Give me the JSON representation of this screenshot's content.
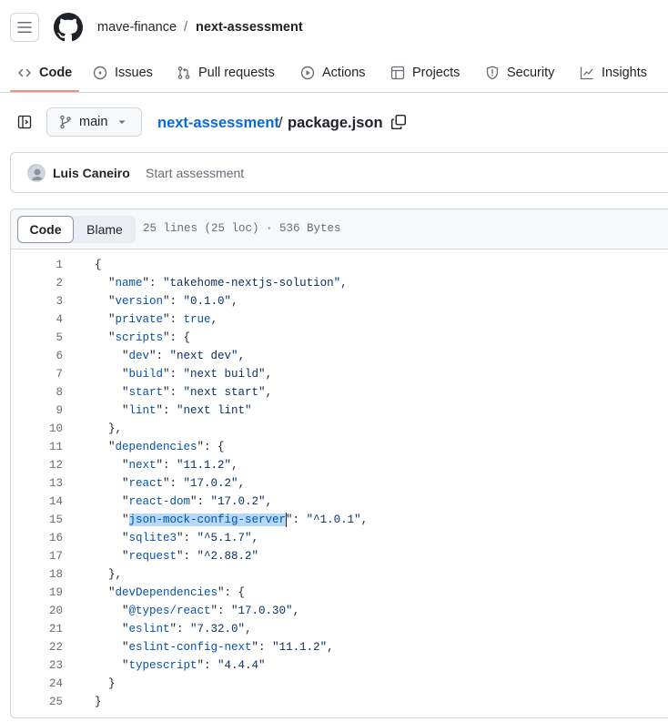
{
  "header": {
    "owner": "mave-finance",
    "separator": "/",
    "repo": "next-assessment"
  },
  "nav": {
    "items": [
      {
        "label": "Code",
        "icon": "code-icon"
      },
      {
        "label": "Issues",
        "icon": "issue-icon"
      },
      {
        "label": "Pull requests",
        "icon": "pull-request-icon"
      },
      {
        "label": "Actions",
        "icon": "play-icon"
      },
      {
        "label": "Projects",
        "icon": "table-icon"
      },
      {
        "label": "Security",
        "icon": "shield-icon"
      },
      {
        "label": "Insights",
        "icon": "graph-icon"
      }
    ],
    "selected": "Code"
  },
  "file": {
    "branch": "main",
    "repo_link": "next-assessment",
    "path_separator": "/",
    "filename": "package.json"
  },
  "commit": {
    "author": "Luis Caneiro",
    "message": "Start assessment"
  },
  "viewer": {
    "tab_code": "Code",
    "tab_blame": "Blame",
    "info": "25 lines (25 loc) · 536 Bytes"
  },
  "code": {
    "line_numbers": [
      "1",
      "2",
      "3",
      "4",
      "5",
      "6",
      "7",
      "8",
      "9",
      "10",
      "11",
      "12",
      "13",
      "14",
      "15",
      "16",
      "17",
      "18",
      "19",
      "20",
      "21",
      "22",
      "23",
      "24",
      "25"
    ],
    "lines": [
      "{",
      "  \"name\": \"takehome-nextjs-solution\",",
      "  \"version\": \"0.1.0\",",
      "  \"private\": true,",
      "  \"scripts\": {",
      "    \"dev\": \"next dev\",",
      "    \"build\": \"next build\",",
      "    \"start\": \"next start\",",
      "    \"lint\": \"next lint\"",
      "  },",
      "  \"dependencies\": {",
      "    \"next\": \"11.1.2\",",
      "    \"react\": \"17.0.2\",",
      "    \"react-dom\": \"17.0.2\",",
      "    \"json-mock-config-server\": \"^1.0.1\",",
      "    \"sqlite3\": \"^5.1.7\",",
      "    \"request\": \"^2.88.2\"",
      "  },",
      "  \"devDependencies\": {",
      "    \"@types/react\": \"17.0.30\",",
      "    \"eslint\": \"7.32.0\",",
      "    \"eslint-config-next\": \"11.1.2\",",
      "    \"typescript\": \"4.4.4\"",
      "  }",
      "}"
    ],
    "selected_text": "json-mock-config-server",
    "selected_line": 15
  },
  "colors": {
    "accent_link": "#0969da",
    "nav_underline": "#fd8c73",
    "selection": "#b6d9fb"
  }
}
